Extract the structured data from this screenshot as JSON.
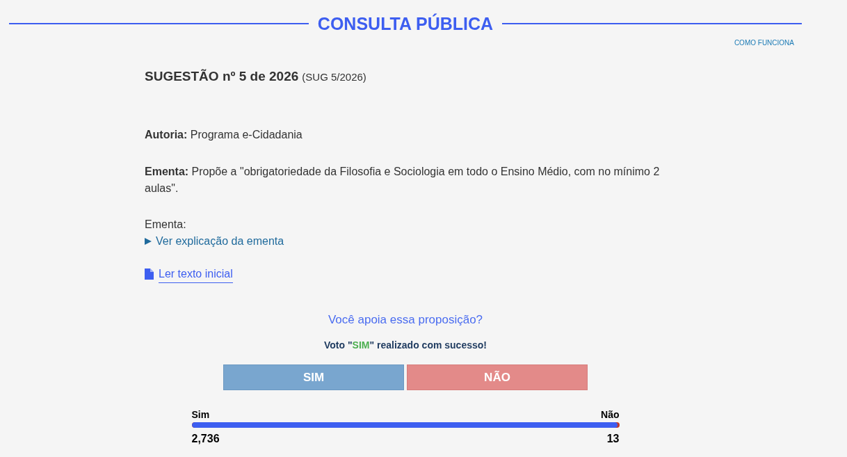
{
  "header": {
    "title": "CONSULTA PÚBLICA",
    "help_link": "COMO FUNCIONA"
  },
  "proposal": {
    "title": "SUGESTÃO nº 5 de 2026",
    "code": "(SUG 5/2026)",
    "fields": [
      "**Autoria:** Programa e-Cidadania",
      "**Ementa:** Propõe a \"obrigatoriedade da Filosofia e Sociologia em todo o Ensino Médio, com no mínimo 2 aulas\"."
    ],
    "explanation": {
      "label": "Ementa:",
      "toggle": "Ver explicação da ementa",
      "expanded": false
    },
    "document_link": "Ler texto inicial"
  },
  "vote": {
    "question": "Você apoia essa proposição?",
    "confirmation": {
      "text_before": "Voto \"",
      "choice": "SIM",
      "text_after": "\" realizado com sucesso!"
    },
    "buttons": [
      {
        "label": "SIM",
        "kind": "yes"
      },
      {
        "label": "NÃO",
        "kind": "no"
      }
    ]
  },
  "results": {
    "yes_label": "Sim",
    "no_label": "Não",
    "level": 0.9953,
    "yes_count": "2,736",
    "no_count": "13"
  }
}
